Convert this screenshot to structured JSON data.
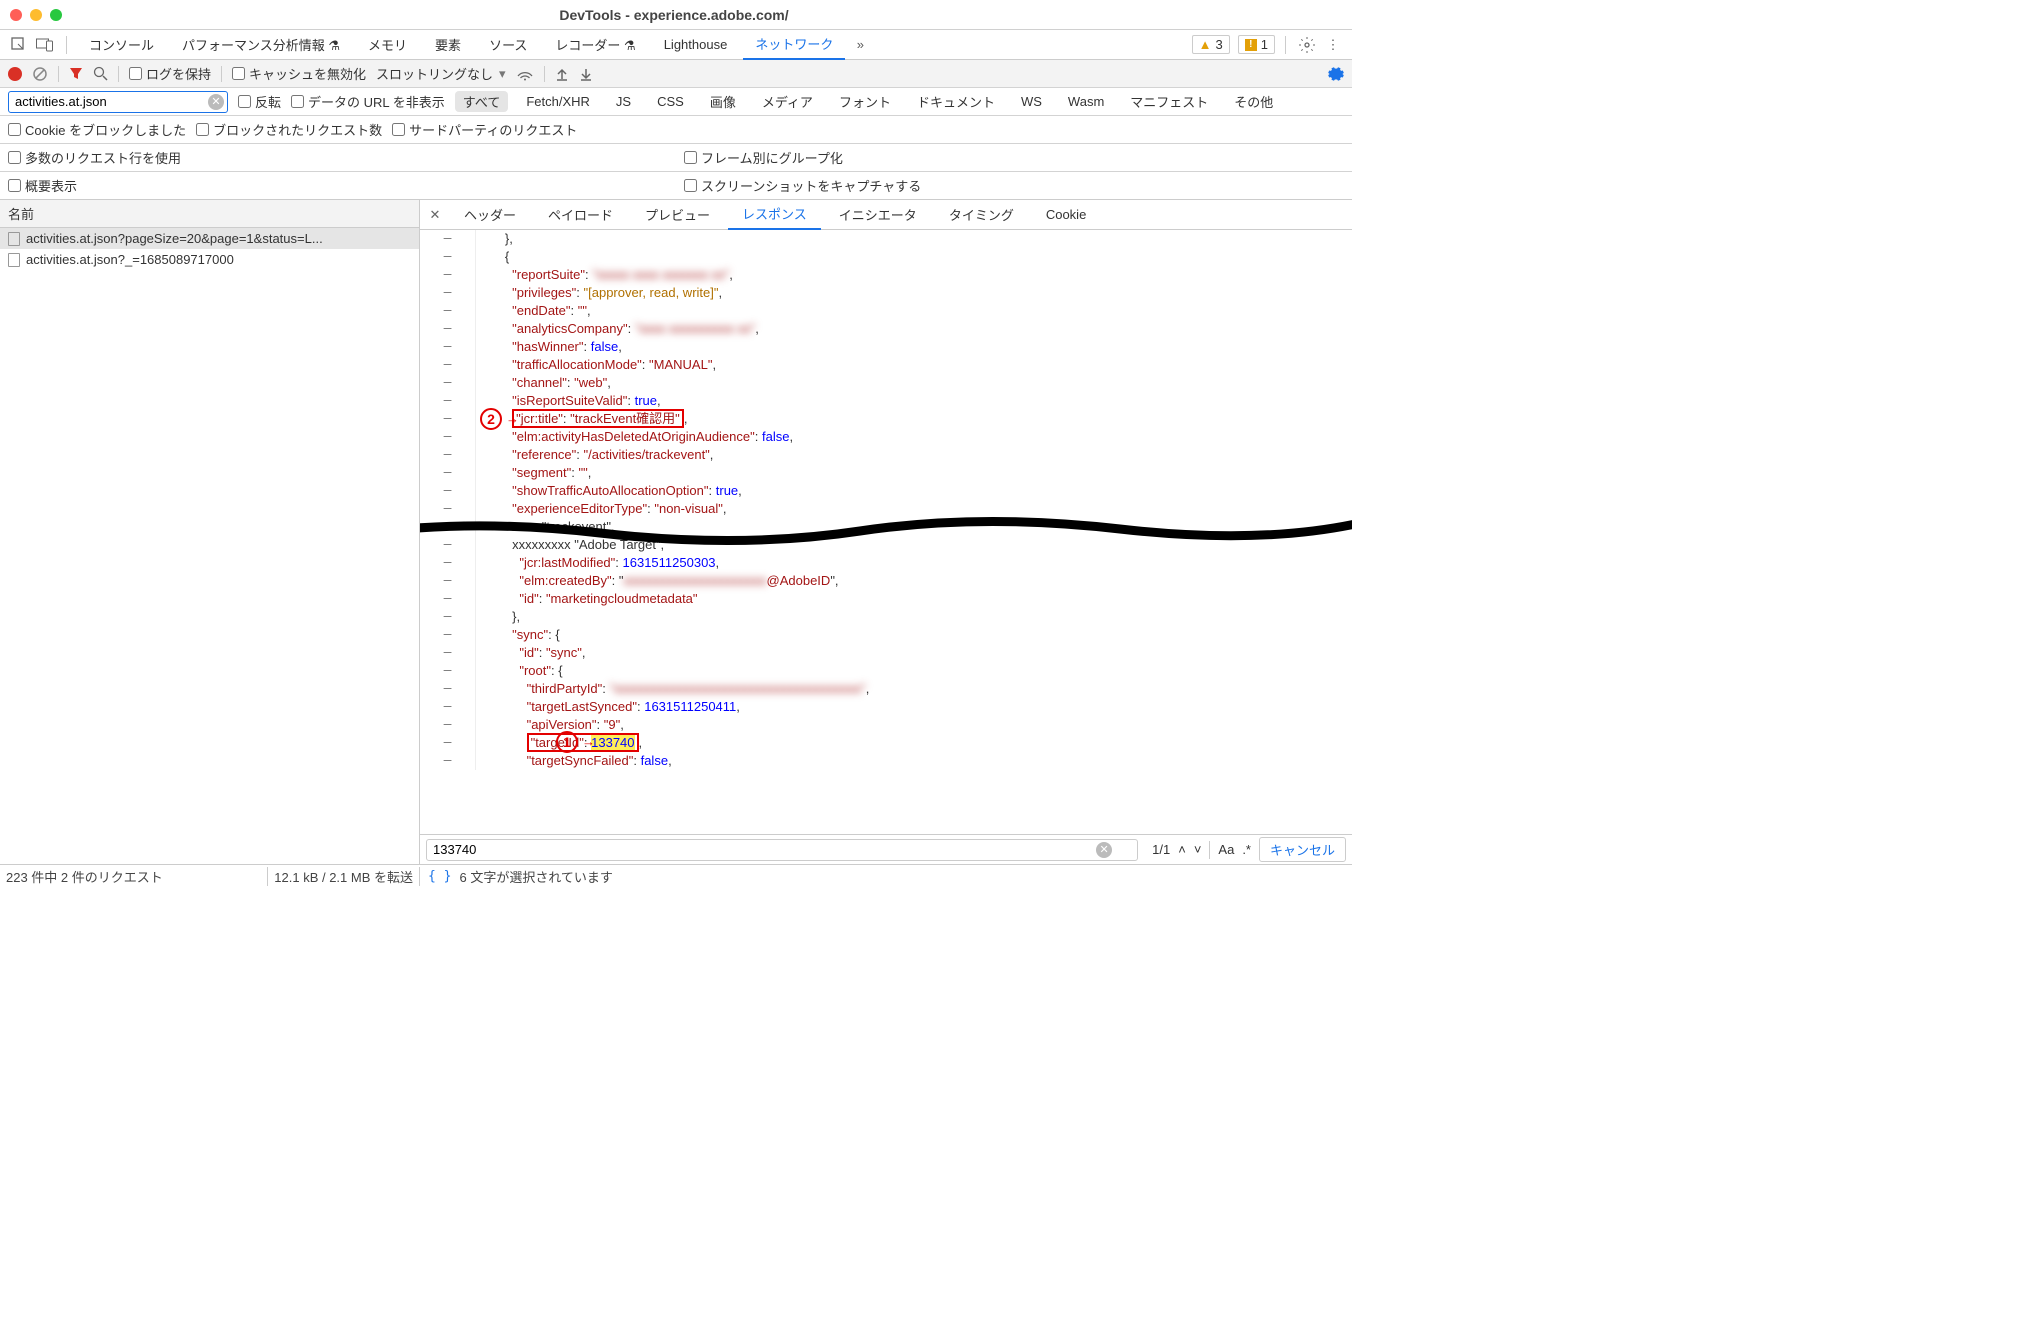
{
  "window": {
    "title": "DevTools - experience.adobe.com/"
  },
  "tabs": {
    "items": [
      "コンソール",
      "パフォーマンス分析情報 ⚗",
      "メモリ",
      "要素",
      "ソース",
      "レコーダー ⚗",
      "Lighthouse",
      "ネットワーク"
    ],
    "active": "ネットワーク",
    "warn_count": "3",
    "issue_count": "1"
  },
  "toolbar": {
    "preserve_log": "ログを保持",
    "disable_cache": "キャッシュを無効化",
    "throttling": "スロットリングなし"
  },
  "filterbar": {
    "value": "activities.at.json",
    "invert": "反転",
    "hide_data_urls": "データの URL を非表示",
    "types": [
      "すべて",
      "Fetch/XHR",
      "JS",
      "CSS",
      "画像",
      "メディア",
      "フォント",
      "ドキュメント",
      "WS",
      "Wasm",
      "マニフェスト",
      "その他"
    ],
    "active_type": "すべて"
  },
  "filter_row2": {
    "block_cookies": "Cookie をブロックしました",
    "blocked_requests": "ブロックされたリクエスト数",
    "third_party": "サードパーティのリクエスト"
  },
  "options": {
    "large_rows": "多数のリクエスト行を使用",
    "group_by_frame": "フレーム別にグループ化",
    "overview": "概要表示",
    "screenshots": "スクリーンショットをキャプチャする"
  },
  "requests": {
    "header": "名前",
    "items": [
      "activities.at.json?pageSize=20&page=1&status=L...",
      "activities.at.json?_=1685089717000"
    ],
    "selected": 0
  },
  "detail_tabs": {
    "items": [
      "ヘッダー",
      "ペイロード",
      "プレビュー",
      "レスポンス",
      "イニシエータ",
      "タイミング",
      "Cookie"
    ],
    "active": "レスポンス"
  },
  "response": {
    "lines": [
      {
        "i": 8,
        "t": "},"
      },
      {
        "i": 8,
        "t": "{"
      },
      {
        "i": 10,
        "k": "reportSuite",
        "sv": "xxxxx xxxx xxxxxxx xx",
        "blur": true,
        "c": ","
      },
      {
        "i": 10,
        "k": "privileges",
        "sv": "[approver, read, write]",
        "orange": true,
        "c": ","
      },
      {
        "i": 10,
        "k": "endDate",
        "sv": "",
        "c": ","
      },
      {
        "i": 10,
        "k": "analyticsCompany",
        "sv": "xxxx xxxxxxxxxx xx",
        "blur": true,
        "c": ","
      },
      {
        "i": 10,
        "k": "hasWinner",
        "bv": "false",
        "c": ","
      },
      {
        "i": 10,
        "k": "trafficAllocationMode",
        "sv": "MANUAL",
        "c": ","
      },
      {
        "i": 10,
        "k": "channel",
        "sv": "web",
        "c": ","
      },
      {
        "i": 10,
        "k": "isReportSuiteValid",
        "bv": "true",
        "c": ","
      },
      {
        "i": 10,
        "k": "jcr:title",
        "sv": "trackEvent確認用",
        "c": ",",
        "box": true,
        "anno": "②"
      },
      {
        "i": 10,
        "k": "elm:activityHasDeletedAtOriginAudience",
        "bv": "false",
        "c": ","
      },
      {
        "i": 10,
        "k": "reference",
        "sv": "/activities/trackevent",
        "c": ","
      },
      {
        "i": 10,
        "k": "segment",
        "sv": "",
        "c": ","
      },
      {
        "i": 10,
        "k": "showTrafficAutoAllocationOption",
        "bv": "true",
        "c": ","
      },
      {
        "i": 10,
        "k": "experienceEditorType",
        "sv": "non-visual",
        "c": ","
      },
      {
        "i": 10,
        "raw": "xxxx \"trackevent\","
      },
      {
        "i": 10,
        "raw": "xxxxxxxxx \"Adobe Target\","
      },
      {
        "i": 12,
        "k": "jcr:lastModified",
        "bv": "1631511250303",
        "c": ","
      },
      {
        "i": 12,
        "k": "elm:createdBy",
        "sv2": "xxxxxxxxxxxxxxxxxxxxxx",
        "tail": "@AdobeID",
        "c": ","
      },
      {
        "i": 12,
        "k": "id",
        "sv": "marketingcloudmetadata"
      },
      {
        "i": 10,
        "t": "},"
      },
      {
        "i": 10,
        "k": "sync",
        "t2": ": {"
      },
      {
        "i": 12,
        "k": "id",
        "sv": "sync",
        "c": ","
      },
      {
        "i": 12,
        "k": "root",
        "t2": ": {"
      },
      {
        "i": 14,
        "k": "thirdPartyId",
        "sv": "xxxxxxxxxxxxxxxxxxxxxxxxxxxxxxxxxxxxxx",
        "blur": true,
        "c": ","
      },
      {
        "i": 14,
        "k": "targetLastSynced",
        "bv": "1631511250411",
        "c": ","
      },
      {
        "i": 14,
        "k": "apiVersion",
        "sv": "9",
        "c": ","
      },
      {
        "i": 14,
        "k": "targetId",
        "hv": "133740",
        "c": ",",
        "box": true,
        "anno": "①"
      },
      {
        "i": 14,
        "k": "targetSyncFailed",
        "bv": "false",
        "c": ","
      }
    ]
  },
  "search": {
    "value": "133740",
    "pos": "1/1",
    "cancel": "キャンセル",
    "case": "Aa",
    "regex": ".*"
  },
  "status": {
    "left1": "223 件中 2 件のリクエスト",
    "left2": "12.1 kB / 2.1 MB を転送",
    "right": "6 文字が選択されています"
  }
}
